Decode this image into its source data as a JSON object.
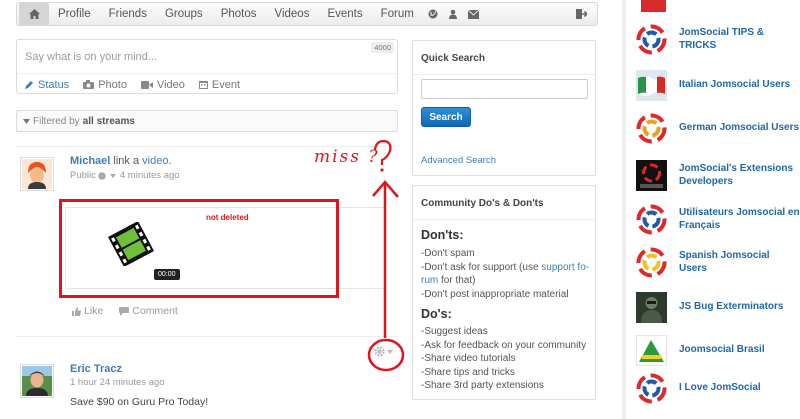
{
  "navbar": {
    "items": [
      "Profile",
      "Friends",
      "Groups",
      "Photos",
      "Videos",
      "Events",
      "Forum"
    ],
    "icons": [
      "home-icon",
      "globe-icon",
      "user-icon",
      "envelope-icon",
      "logout-icon"
    ]
  },
  "composer": {
    "placeholder": "Say what is on your mind...",
    "counter": "4000",
    "tabs": [
      "Status",
      "Photo",
      "Video",
      "Event"
    ]
  },
  "filter": {
    "prefix": "Filtered by",
    "value": "all streams"
  },
  "stream": [
    {
      "actor": "Michael",
      "verb": "link a",
      "object": "video",
      "privacy": "Public",
      "time": "4 minutes ago",
      "video_duration": "00:00",
      "like_label": "Like",
      "comment_label": "Comment"
    },
    {
      "actor": "Eric Tracz",
      "time": "1 hour 24 minutes ago",
      "text": "Save $90 on Guru Pro Today!"
    }
  ],
  "annotation": {
    "note": "not deleted",
    "scribble": "miss ?"
  },
  "quick_search": {
    "title": "Quick Search",
    "button": "Search",
    "advanced": "Advanced Search"
  },
  "community_rules": {
    "title": "Community Do's & Don'ts",
    "donts_heading": "Don'ts:",
    "donts_1": "-Don't spam",
    "donts_2_pre": "-Don't ask for support (use ",
    "donts_2_link_a": "support fo-",
    "donts_2_link_b": "rum",
    "donts_2_post": " for that)",
    "donts_3": "-Don't post inappropriate material",
    "dos_heading": "Do's:",
    "dos": [
      "-Suggest ideas",
      "-Ask for feedback on your community",
      "-Share video tutorials",
      "-Share tips and tricks",
      "-Share 3rd party extensions"
    ]
  },
  "groups": [
    {
      "line1": "JomSocial TIPS & TRICKS",
      "line2": ""
    },
    {
      "line1": "Italian Jomsocial Users",
      "line2": ""
    },
    {
      "line1": "German Jomsocial Users",
      "line2": ""
    },
    {
      "line1": "JomSocial's Extensions",
      "line2": "Developers"
    },
    {
      "line1": "Utilisateurs Jomsocial en",
      "line2": "Français"
    },
    {
      "line1": "Spanish Jomsocial Users",
      "line2": ""
    },
    {
      "line1": "JS Bug Exterminators",
      "line2": ""
    },
    {
      "line1": "Joomsocial Brasil",
      "line2": ""
    },
    {
      "line1": "I Love JomSocial",
      "line2": ""
    }
  ],
  "colors": {
    "link": "#3b7fb6",
    "button": "#1a78c8",
    "annotation": "#e0151b",
    "group_link": "#1f67a8"
  }
}
